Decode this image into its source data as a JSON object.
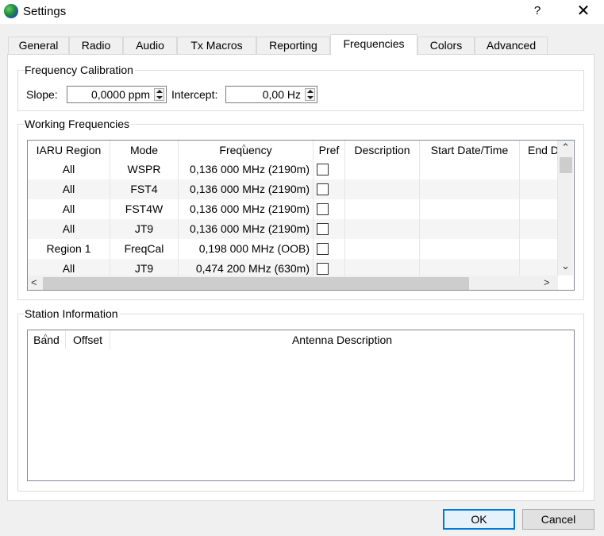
{
  "window": {
    "title": "Settings",
    "help_label": "?",
    "close_label": "✕"
  },
  "tabs": [
    {
      "label": "General"
    },
    {
      "label": "Radio"
    },
    {
      "label": "Audio"
    },
    {
      "label": "Tx Macros"
    },
    {
      "label": "Reporting"
    },
    {
      "label": "Frequencies",
      "active": true
    },
    {
      "label": "Colors"
    },
    {
      "label": "Advanced"
    }
  ],
  "calibration": {
    "title": "Frequency Calibration",
    "slope_label": "Slope:",
    "slope_value": "0,0000 ppm",
    "intercept_label": "Intercept:",
    "intercept_value": "0,00 Hz"
  },
  "working": {
    "title": "Working Frequencies",
    "columns": [
      "IARU Region",
      "Mode",
      "Frequency",
      "Pref",
      "Description",
      "Start Date/Time",
      "End D"
    ],
    "sorted_column": "Frequency",
    "rows": [
      {
        "region": "All",
        "mode": "WSPR",
        "frequency": "0,136 000 MHz (2190m)",
        "pref": false,
        "description": "",
        "start": "",
        "end": ""
      },
      {
        "region": "All",
        "mode": "FST4",
        "frequency": "0,136 000 MHz (2190m)",
        "pref": false,
        "description": "",
        "start": "",
        "end": ""
      },
      {
        "region": "All",
        "mode": "FST4W",
        "frequency": "0,136 000 MHz (2190m)",
        "pref": false,
        "description": "",
        "start": "",
        "end": ""
      },
      {
        "region": "All",
        "mode": "JT9",
        "frequency": "0,136 000 MHz (2190m)",
        "pref": false,
        "description": "",
        "start": "",
        "end": ""
      },
      {
        "region": "Region 1",
        "mode": "FreqCal",
        "frequency": "0,198 000 MHz (OOB)",
        "pref": false,
        "description": "",
        "start": "",
        "end": ""
      },
      {
        "region": "All",
        "mode": "JT9",
        "frequency": "0,474 200 MHz (630m)",
        "pref": false,
        "description": "",
        "start": "",
        "end": ""
      }
    ]
  },
  "station": {
    "title": "Station Information",
    "columns": [
      "Band",
      "Offset",
      "Antenna Description"
    ],
    "sorted_column": "Band"
  },
  "buttons": {
    "ok": "OK",
    "cancel": "Cancel"
  },
  "scroll_icons": {
    "up": "chevron-up-icon",
    "down": "chevron-down-icon",
    "left": "chevron-left-icon",
    "right": "chevron-right-icon"
  }
}
